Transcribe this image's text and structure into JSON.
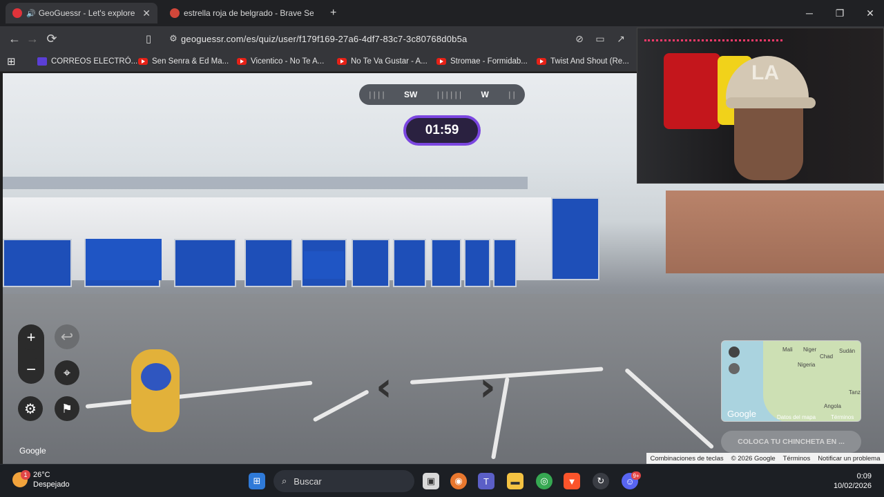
{
  "browser": {
    "tabs": [
      {
        "title": "GeoGuessr - Let's explore the",
        "active": true
      },
      {
        "title": "estrella roja de belgrado - Brave Sear",
        "active": false
      }
    ],
    "new_tab": "+",
    "url": "geoguessr.com/es/quiz/user/f179f169-27a6-4df7-83c7-3c80768d0b5a",
    "bookmarks": [
      {
        "label": "CORREOS ELECTRÓ...",
        "icon": "mail-icon"
      },
      {
        "label": "Sen Senra & Ed Ma...",
        "icon": "youtube-icon"
      },
      {
        "label": "Vicentico - No Te A...",
        "icon": "youtube-icon"
      },
      {
        "label": "No Te Va Gustar - A...",
        "icon": "youtube-icon"
      },
      {
        "label": "Stromae - Formidab...",
        "icon": "youtube-icon"
      },
      {
        "label": "Twist And Shout (Re...",
        "icon": "youtube-icon"
      }
    ]
  },
  "game": {
    "compass": {
      "left": "SW",
      "right": "W"
    },
    "timer": "01:59",
    "controls": {
      "zoom_in": "+",
      "zoom_out": "−",
      "undo": "↩"
    },
    "watermark": "Google",
    "minimap": {
      "labels": [
        "Mali",
        "Niger",
        "Chad",
        "Sudán",
        "Nigeria",
        "Angola",
        "Tanz"
      ],
      "logo": "Google",
      "attribution": "Datos del mapa",
      "terms": "Términos"
    },
    "place_pin_button": "COLOCA TU CHINCHETA EN ...",
    "footer": [
      "Combinaciones de teclas",
      "© 2026 Google",
      "Términos",
      "Notificar un problema"
    ]
  },
  "webcam": {
    "cap_text": "LA"
  },
  "taskbar": {
    "weather": {
      "temp": "26°C",
      "desc": "Despejado",
      "alert_count": "1"
    },
    "search_placeholder": "Buscar",
    "discord_badge": "9+",
    "time": "0:09",
    "date": "10/02/2026"
  },
  "colors": {
    "timer_border": "#7b46e0",
    "accent_blue": "#1e4fb8"
  }
}
